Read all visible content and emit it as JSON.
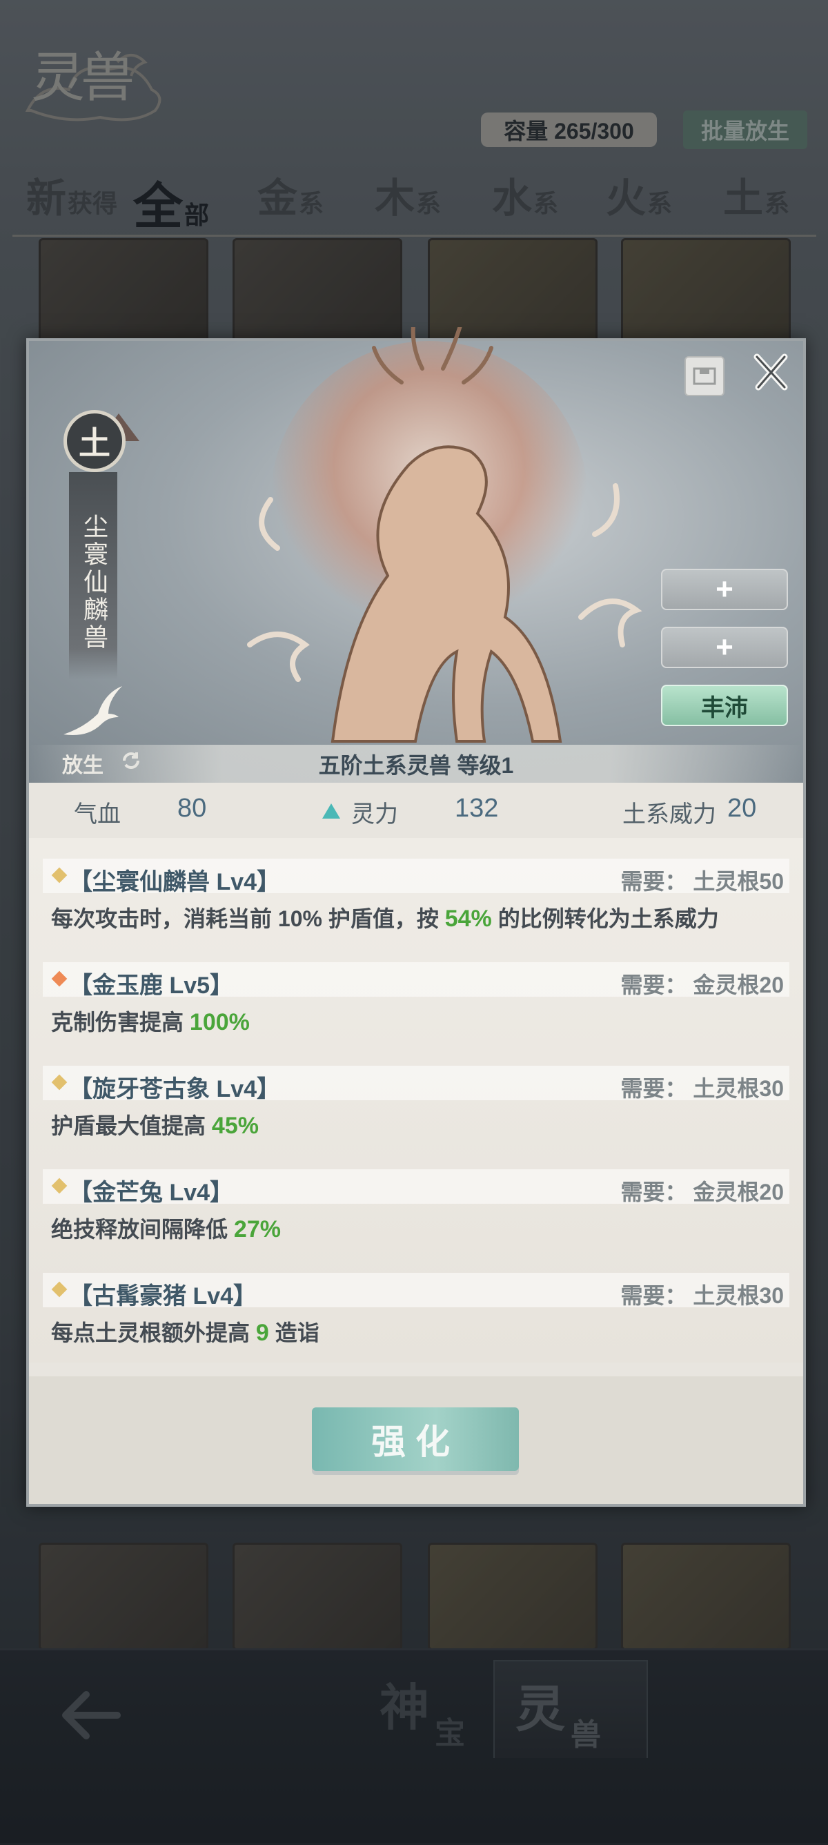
{
  "header": {
    "logo_text": "灵兽",
    "capacity": "容量 265/300",
    "batch_release": "批量放生"
  },
  "tabs": [
    {
      "big": "新",
      "small": "获得"
    },
    {
      "big": "全",
      "small": "部"
    },
    {
      "big": "金",
      "small": "系"
    },
    {
      "big": "木",
      "small": "系"
    },
    {
      "big": "水",
      "small": "系"
    },
    {
      "big": "火",
      "small": "系"
    },
    {
      "big": "土",
      "small": "系"
    }
  ],
  "modal": {
    "element": "土",
    "beast_name": "尘寰仙麟兽",
    "release_label": "放生",
    "slots": [
      "+",
      "+",
      "丰沛"
    ],
    "caption": "五阶土系灵兽    等级1",
    "stats": {
      "hp_label": "气血",
      "hp_value": "80",
      "power_label": "灵力",
      "power_value": "132",
      "element_power_label": "土系威力",
      "element_power_value": "20"
    },
    "skills": [
      {
        "name": "【尘寰仙麟兽 Lv4】",
        "req": "需要：  土灵根50",
        "color": "gold",
        "desc_pre": "每次攻击时，消耗当前 10% 护盾值，按 ",
        "desc_hl": "54%",
        "desc_post": " 的比例转化为土系威力"
      },
      {
        "name": "【金玉鹿 Lv5】",
        "req": "需要：  金灵根20",
        "color": "orange",
        "desc_pre": "克制伤害提高 ",
        "desc_hl": "100%",
        "desc_post": ""
      },
      {
        "name": "【旋牙苍古象 Lv4】",
        "req": "需要：  土灵根30",
        "color": "gold",
        "desc_pre": "护盾最大值提高 ",
        "desc_hl": "45%",
        "desc_post": ""
      },
      {
        "name": "【金芒兔 Lv4】",
        "req": "需要：  金灵根20",
        "color": "gold",
        "desc_pre": "绝技释放间隔降低 ",
        "desc_hl": "27%",
        "desc_post": ""
      },
      {
        "name": "【古髯豪猪 Lv4】",
        "req": "需要：  土灵根30",
        "color": "gold",
        "desc_pre": "每点土灵根额外提高 ",
        "desc_hl": "9",
        "desc_post": " 造诣"
      }
    ],
    "enhance_label": "强化"
  },
  "bottom": {
    "tab1_big": "神",
    "tab1_small": "宝",
    "tab2_big": "灵",
    "tab2_small": "兽"
  }
}
